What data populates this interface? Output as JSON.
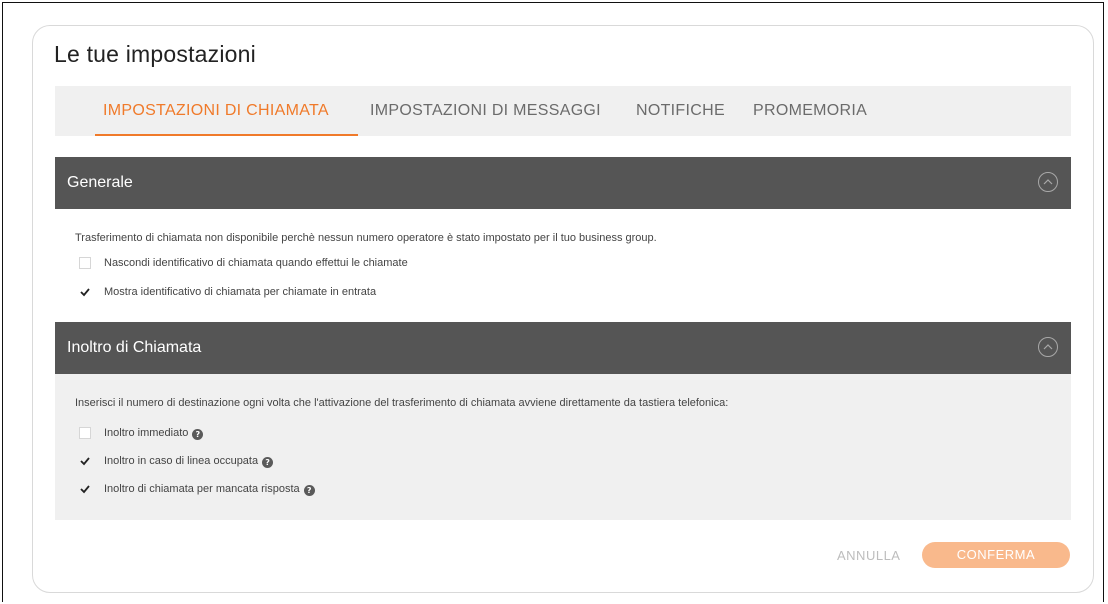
{
  "page": {
    "title": "Le tue impostazioni"
  },
  "tabs": [
    {
      "label": "IMPOSTAZIONI DI CHIAMATA",
      "active": true
    },
    {
      "label": "IMPOSTAZIONI DI MESSAGGI",
      "active": false
    },
    {
      "label": "NOTIFICHE",
      "active": false
    },
    {
      "label": "PROMEMORIA",
      "active": false
    }
  ],
  "sections": [
    {
      "title": "Generale",
      "collapse_icon": "chevron-up-circle-icon",
      "description": "Trasferimento di chiamata non disponibile perchè nessun numero operatore è stato impostato per il tuo business group.",
      "options": [
        {
          "label": "Nascondi identificativo di chiamata quando effettui le chiamate",
          "checked": false,
          "help": false
        },
        {
          "label": "Mostra identificativo di chiamata per chiamate in entrata",
          "checked": true,
          "help": false
        }
      ]
    },
    {
      "title": "Inoltro di Chiamata",
      "collapse_icon": "chevron-up-circle-icon",
      "description": "Inserisci il numero di destinazione ogni volta che l'attivazione del trasferimento di chiamata avviene direttamente da tastiera telefonica:",
      "options": [
        {
          "label": "Inoltro immediato",
          "checked": false,
          "help": true
        },
        {
          "label": "Inoltro in caso di linea occupata",
          "checked": true,
          "help": true
        },
        {
          "label": "Inoltro di chiamata per mancata risposta",
          "checked": true,
          "help": true
        }
      ]
    }
  ],
  "help_icon_glyph": "?",
  "actions": {
    "cancel_label": "ANNULLA",
    "confirm_label": "CONFERMA"
  },
  "colors": {
    "accent": "#f07a2a",
    "confirm_button": "#f9b98c",
    "section_header": "#555555",
    "tab_bar": "#f0f0f0"
  }
}
